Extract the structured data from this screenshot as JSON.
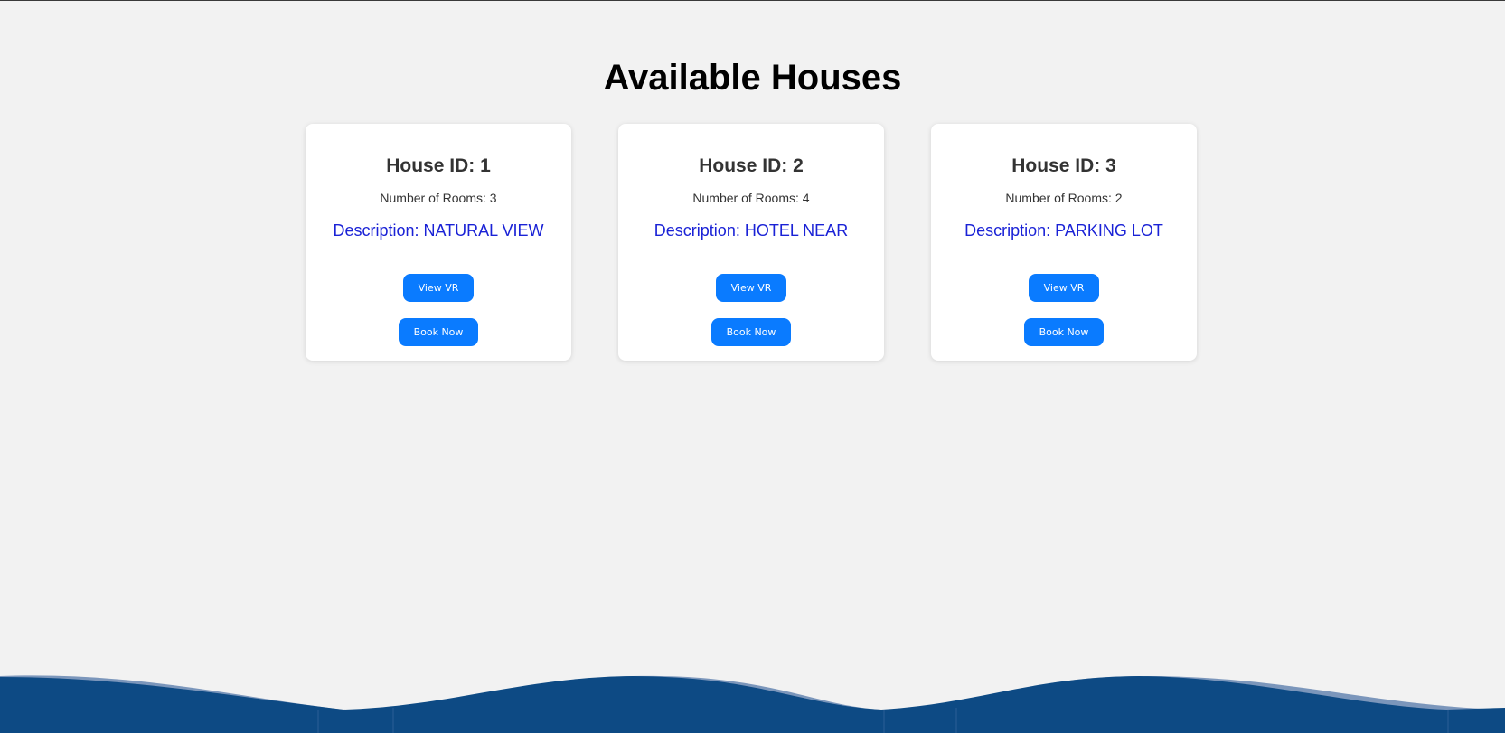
{
  "page": {
    "title": "Available Houses"
  },
  "houses": [
    {
      "title": "House ID: 1",
      "rooms": "Number of Rooms: 3",
      "description": "Description: NATURAL VIEW",
      "view_vr_label": "View VR",
      "book_label": "Book Now"
    },
    {
      "title": "House ID: 2",
      "rooms": "Number of Rooms: 4",
      "description": "Description: HOTEL NEAR",
      "view_vr_label": "View VR",
      "book_label": "Book Now"
    },
    {
      "title": "House ID: 3",
      "rooms": "Number of Rooms: 2",
      "description": "Description: PARKING LOT",
      "view_vr_label": "View VR",
      "book_label": "Book Now"
    }
  ],
  "colors": {
    "background": "#f2f2f2",
    "card": "#ffffff",
    "button": "#0a7bff",
    "description": "#1a22d6",
    "wave_dark": "#0d4a84",
    "wave_light": "#7b96bb"
  }
}
